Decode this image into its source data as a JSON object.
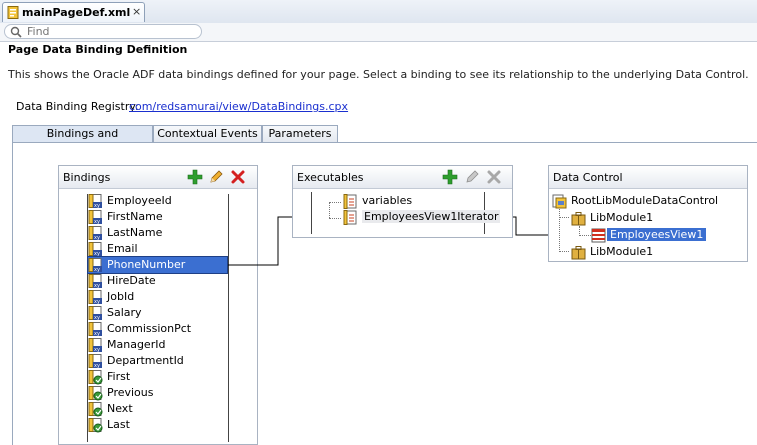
{
  "editor_tab": {
    "label": "mainPageDef.xml",
    "close": "×"
  },
  "find": {
    "placeholder": "Find"
  },
  "header": {
    "title": "Page Data Binding Definition",
    "description": "This shows the Oracle ADF data bindings defined for your page. Select a binding to see its relationship to the underlying Data Control."
  },
  "registry": {
    "label": "Data Binding Registry:",
    "link": "com/redsamurai/view/DataBindings.cpx"
  },
  "subtabs": [
    "Bindings and Executables",
    "Contextual Events",
    "Parameters"
  ],
  "bindings": {
    "title": "Bindings",
    "items": [
      "EmployeeId",
      "FirstName",
      "LastName",
      "Email",
      "PhoneNumber",
      "HireDate",
      "JobId",
      "Salary",
      "CommissionPct",
      "ManagerId",
      "DepartmentId",
      "First",
      "Previous",
      "Next",
      "Last"
    ],
    "selected": "PhoneNumber"
  },
  "executables": {
    "title": "Executables",
    "items": [
      "variables",
      "EmployeesView1Iterator"
    ]
  },
  "data_control": {
    "title": "Data Control",
    "root": "RootLibModuleDataControl",
    "module1": "LibModule1",
    "view": "EmployeesView1",
    "module2": "LibModule1"
  },
  "colors": {
    "selection": "#3b6fd1",
    "link": "#1a2fcf",
    "add": "#2e9e2e",
    "delete": "#d42020"
  }
}
